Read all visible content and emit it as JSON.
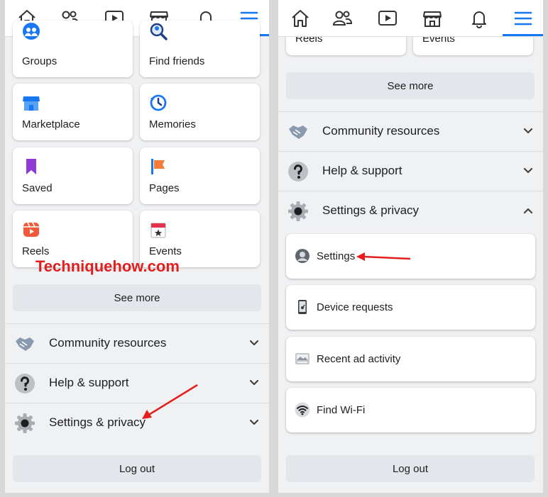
{
  "left": {
    "shortcuts": [
      {
        "label": "Groups",
        "icon": "groups-icon"
      },
      {
        "label": "Find friends",
        "icon": "find-friends-icon"
      },
      {
        "label": "Marketplace",
        "icon": "marketplace-icon"
      },
      {
        "label": "Memories",
        "icon": "memories-icon"
      },
      {
        "label": "Saved",
        "icon": "saved-icon"
      },
      {
        "label": "Pages",
        "icon": "pages-icon"
      },
      {
        "label": "Reels",
        "icon": "reels-icon"
      },
      {
        "label": "Events",
        "icon": "events-icon"
      }
    ],
    "see_more": "See more",
    "sections": [
      {
        "label": "Community resources",
        "icon": "handshake-icon"
      },
      {
        "label": "Help & support",
        "icon": "question-icon"
      },
      {
        "label": "Settings & privacy",
        "icon": "gear-icon"
      }
    ],
    "logout": "Log out"
  },
  "right": {
    "shortcuts": [
      {
        "label": "Reels",
        "icon": "reels-icon"
      },
      {
        "label": "Events",
        "icon": "events-icon"
      }
    ],
    "see_more": "See more",
    "sections": [
      {
        "label": "Community resources",
        "icon": "handshake-icon",
        "state": "collapsed"
      },
      {
        "label": "Help & support",
        "icon": "question-icon",
        "state": "collapsed"
      },
      {
        "label": "Settings & privacy",
        "icon": "gear-icon",
        "state": "expanded"
      }
    ],
    "submenu": [
      {
        "label": "Settings",
        "icon": "profile-circle-icon"
      },
      {
        "label": "Device requests",
        "icon": "phone-icon"
      },
      {
        "label": "Recent ad activity",
        "icon": "ad-activity-icon"
      },
      {
        "label": "Find Wi-Fi",
        "icon": "wifi-icon"
      }
    ],
    "logout": "Log out"
  },
  "watermark": "Techniquehow.com",
  "colors": {
    "accent": "#1877f2",
    "annotation": "#e41e1e"
  }
}
